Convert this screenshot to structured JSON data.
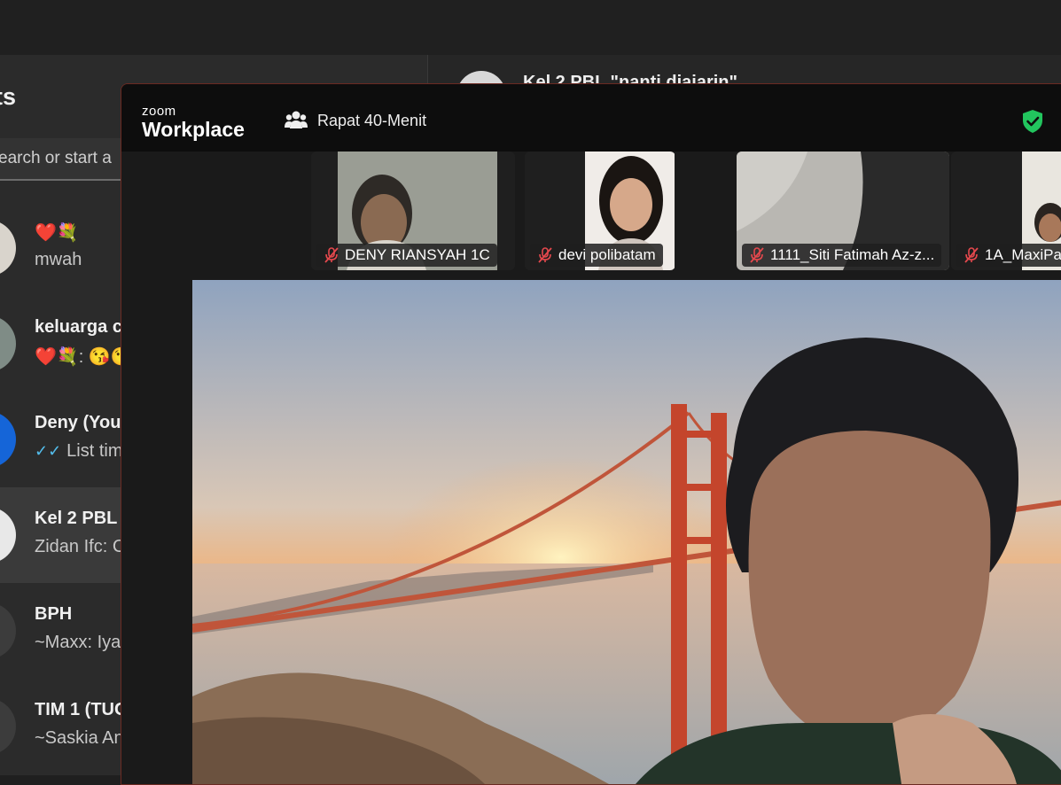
{
  "whatsapp": {
    "heading": "ts",
    "search_placeholder": "earch or start a",
    "chat_header_title": "Kel 2 PBL \"nanti diajarin\"",
    "chats": [
      {
        "name": "❤️💐",
        "preview": "mwah"
      },
      {
        "name": "keluarga c",
        "preview": "❤️💐: 😘😘"
      },
      {
        "name": "Deny (You",
        "preview": "List tim",
        "read_ticks": "✓✓"
      },
      {
        "name": "Kel 2 PBL",
        "preview": "Zidan Ifc: C"
      },
      {
        "name": "BPH",
        "preview": "~Maxx: Iya"
      },
      {
        "name": "TIM 1 (TUG",
        "preview": "~Saskia An"
      }
    ]
  },
  "zoom": {
    "logo_top": "zoom",
    "logo_bottom": "Workplace",
    "meeting_title": "Rapat 40-Menit",
    "accent_border": "#6b2a22",
    "security_color": "#22c55e",
    "participants": [
      {
        "name": "DENY RIANSYAH 1C",
        "muted": true
      },
      {
        "name": "devi polibatam",
        "muted": true
      },
      {
        "name": "1111_Siti Fatimah Az-z...",
        "muted": true
      },
      {
        "name": "1A_MaxiPa",
        "muted": true
      }
    ],
    "main_video_background": "Golden Gate Bridge at sunset"
  }
}
